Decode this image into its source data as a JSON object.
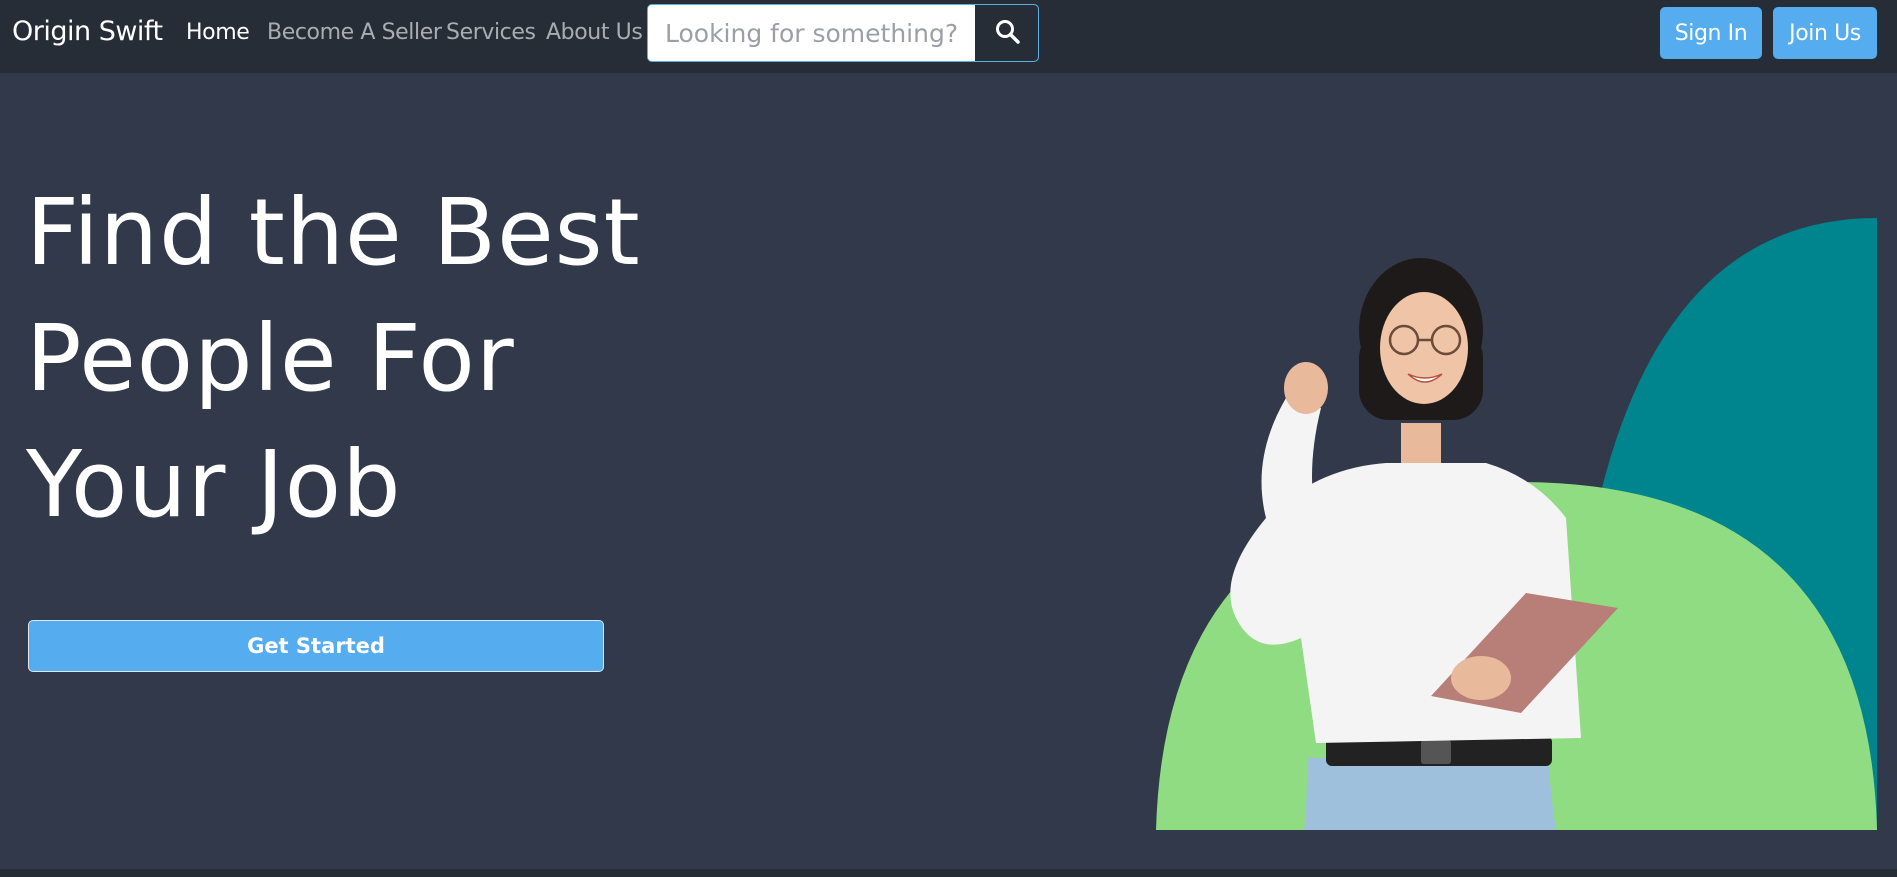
{
  "navbar": {
    "brand": "Origin Swift",
    "links": [
      {
        "label": "Home",
        "active": true
      },
      {
        "label": "Become A Seller",
        "active": false
      },
      {
        "label": "Services",
        "active": false
      },
      {
        "label": "About Us",
        "active": false
      }
    ],
    "search": {
      "placeholder": "Looking for something?",
      "value": "",
      "button_icon": "search-icon"
    },
    "sign_in_label": "Sign In",
    "join_label": "Join Us"
  },
  "hero": {
    "title_lines": [
      "Find the Best",
      "People For",
      "Your Job"
    ],
    "cta_label": "Get Started",
    "image": "woman-with-glasses-holding-tablet"
  },
  "colors": {
    "navbar_bg": "#272d36",
    "page_bg": "#31394a",
    "accent_blue": "#55acee",
    "teal": "#00848d",
    "light_green": "#8fdc82"
  }
}
